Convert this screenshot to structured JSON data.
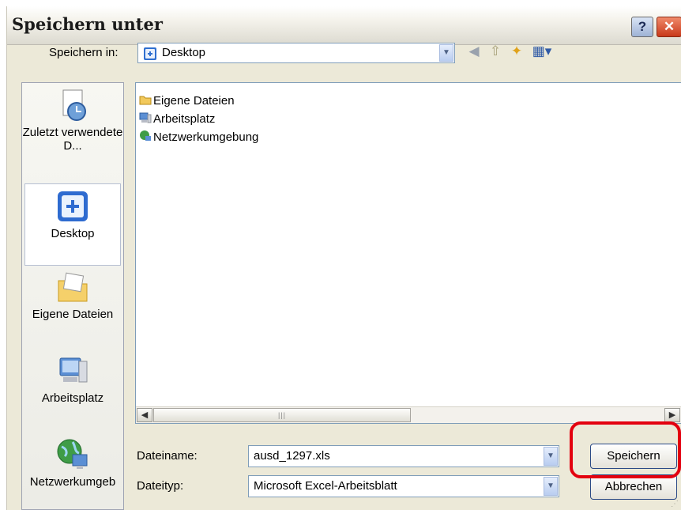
{
  "window": {
    "title": "Speichern unter"
  },
  "titlebar_buttons": {
    "help": "?",
    "close": "✕"
  },
  "toolbar": {
    "save_in_label": "Speichern in:",
    "save_in_value": "Desktop",
    "icons": [
      "back-icon",
      "up-folder-icon",
      "new-folder-icon",
      "view-menu-icon"
    ]
  },
  "places": [
    {
      "label": "Zuletzt verwendete D...",
      "icon": "recent-documents-icon",
      "selected": false
    },
    {
      "label": "Desktop",
      "icon": "desktop-icon",
      "selected": true
    },
    {
      "label": "Eigene Dateien",
      "icon": "my-documents-icon",
      "selected": false
    },
    {
      "label": "Arbeitsplatz",
      "icon": "my-computer-icon",
      "selected": false
    },
    {
      "label": "Netzwerkumgeb",
      "icon": "network-icon",
      "selected": false
    }
  ],
  "files": [
    {
      "name": "Eigene Dateien",
      "icon": "folder-icon"
    },
    {
      "name": "Arbeitsplatz",
      "icon": "computer-icon"
    },
    {
      "name": "Netzwerkumgebung",
      "icon": "network-icon"
    }
  ],
  "filename": {
    "label": "Dateiname:",
    "value": "ausd_1297.xls"
  },
  "filetype": {
    "label": "Dateityp:",
    "value": "Microsoft Excel-Arbeitsblatt"
  },
  "buttons": {
    "save": "Speichern",
    "cancel": "Abbrechen"
  },
  "colors": {
    "highlight": "#e3000f",
    "dialog_bg": "#ece9d8",
    "title_text": "#1a1a1a"
  }
}
